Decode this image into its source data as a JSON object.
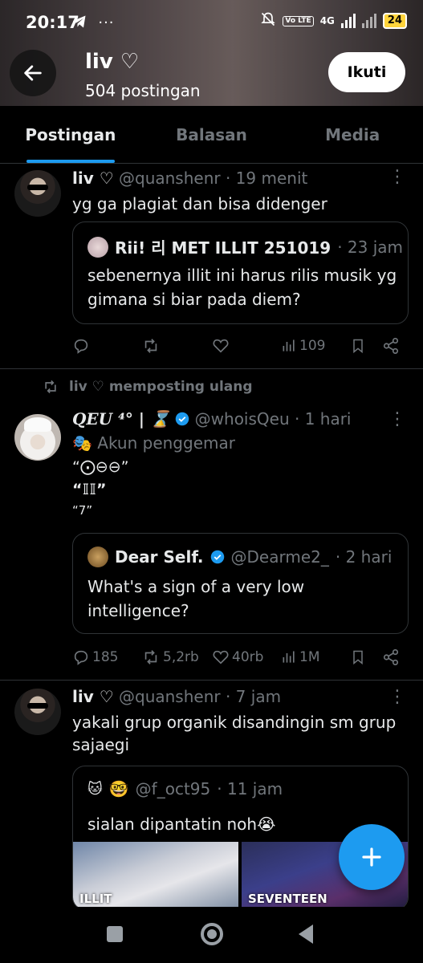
{
  "status_bar": {
    "time": "20:17",
    "left_icons": "◢ ···",
    "network": "4G",
    "volte": "Vo LTE",
    "battery": "24"
  },
  "header": {
    "name": "liv ♡",
    "post_count": "504 postingan",
    "follow_label": "Ikuti"
  },
  "tabs": [
    {
      "label": "Postingan",
      "active": true
    },
    {
      "label": "Balasan",
      "active": false
    },
    {
      "label": "Media",
      "active": false
    }
  ],
  "posts": [
    {
      "name": "liv ♡",
      "handle": "@quanshenr",
      "time": "· 19 menit",
      "text": "yg ga plagiat dan bisa didenger",
      "quote": {
        "name": "Rii! 리 MET ILLIT 251019",
        "time": "· 23 jam",
        "text_lines": [
          "sebenernya illit ini harus rilis musik yg",
          "gimana si biar pada diem?"
        ]
      },
      "stats": {
        "replies": "",
        "reposts": "",
        "likes": "",
        "views": "109"
      }
    },
    {
      "repost_label": "liv ♡ memposting ulang",
      "name": "𝑸𝑬𝑼 ⁴° | ⌛",
      "handle": "@whoisQeu",
      "time": "· 1 hari",
      "subtitle": "Akun penggemar",
      "text_lines": [
        "“⨀⊖⊖”",
        "“𝕀𝕀”",
        "“7”"
      ],
      "quote": {
        "name": "Dear Self.",
        "handle": "@Dearme2_",
        "time": "· 2 hari",
        "text_lines": [
          "What's a sign of a very low",
          "intelligence?"
        ]
      },
      "stats": {
        "replies": "185",
        "reposts": "5,2rb",
        "likes": "40rb",
        "views": "1M"
      }
    },
    {
      "name": "liv ♡",
      "handle": "@quanshenr",
      "time": "· 7 jam",
      "text_lines": [
        "yakali grup organik disandingin sm grup",
        "sajaegi"
      ],
      "quote": {
        "name": "🤓",
        "handle": "@f_oct95",
        "time": "· 11 jam",
        "text": "sialan dipantatin noh😭",
        "media": [
          {
            "label": "ILLIT"
          },
          {
            "label": "SEVENTEEN"
          }
        ]
      }
    }
  ],
  "colors": {
    "accent": "#1d9bf0",
    "muted": "#71767b",
    "border": "#2f3336"
  }
}
